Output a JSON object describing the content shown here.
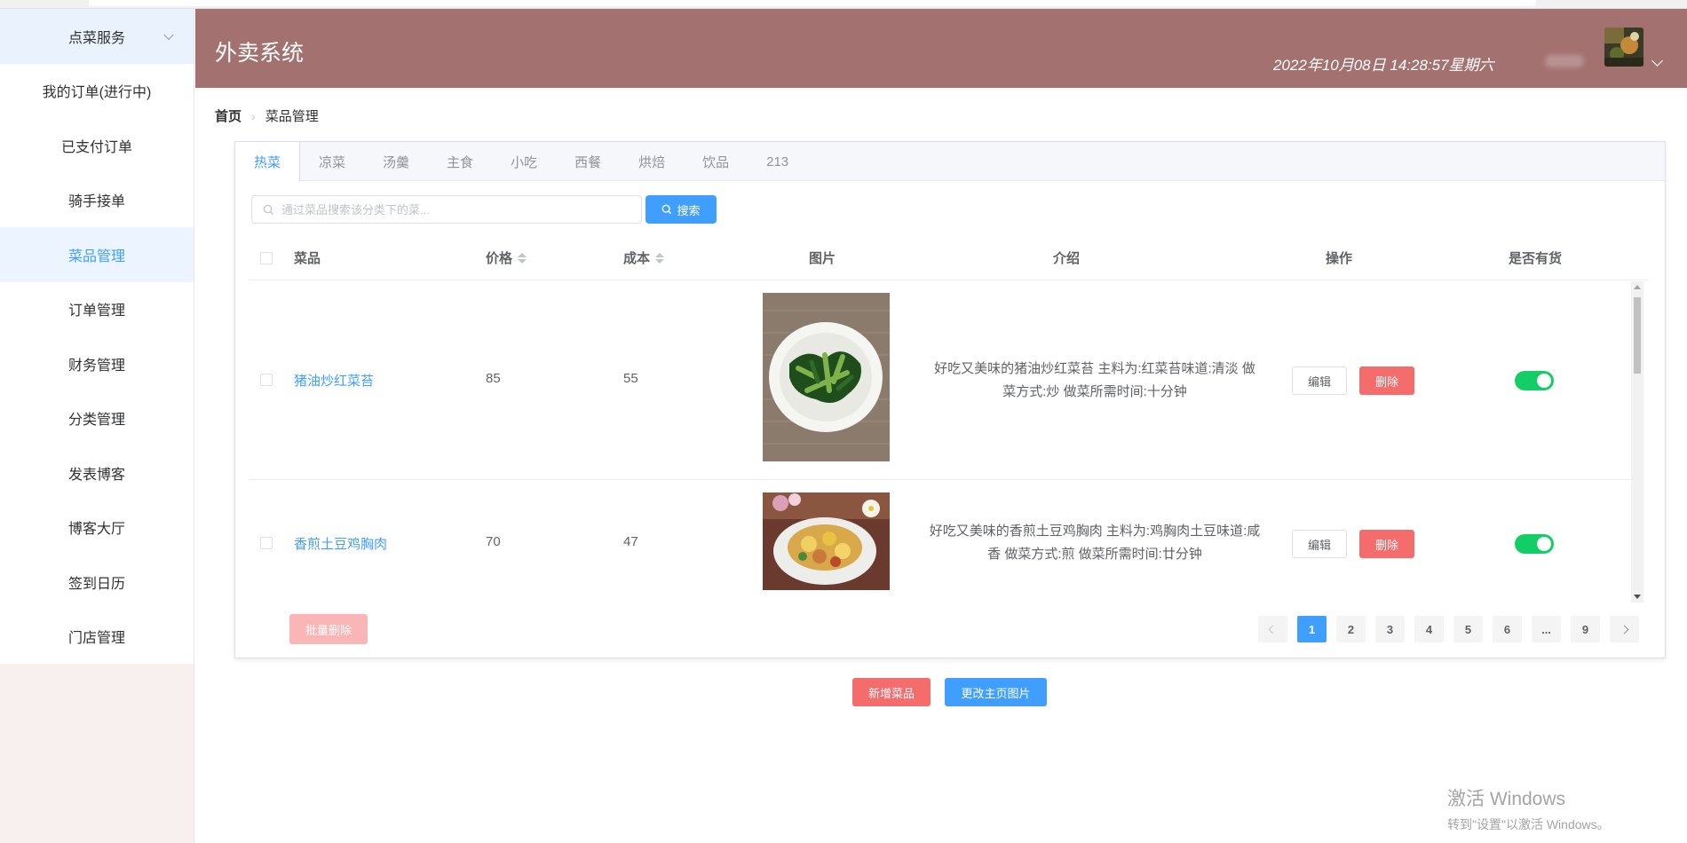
{
  "app": {
    "title": "外卖系统",
    "datetime": "2022年10月08日 14:28:57星期六"
  },
  "sidebar": {
    "items": [
      {
        "label": "点菜服务"
      },
      {
        "label": "我的订单(进行中)"
      },
      {
        "label": "已支付订单"
      },
      {
        "label": "骑手接单"
      },
      {
        "label": "菜品管理"
      },
      {
        "label": "订单管理"
      },
      {
        "label": "财务管理"
      },
      {
        "label": "分类管理"
      },
      {
        "label": "发表博客"
      },
      {
        "label": "博客大厅"
      },
      {
        "label": "签到日历"
      },
      {
        "label": "门店管理"
      }
    ]
  },
  "breadcrumb": {
    "home": "首页",
    "current": "菜品管理"
  },
  "tabs": [
    "热菜",
    "凉菜",
    "汤羹",
    "主食",
    "小吃",
    "西餐",
    "烘焙",
    "饮品",
    "213"
  ],
  "search": {
    "placeholder": "通过菜品搜索该分类下的菜...",
    "button": "搜索"
  },
  "table": {
    "headers": {
      "dish": "菜品",
      "price": "价格",
      "cost": "成本",
      "image": "图片",
      "intro": "介绍",
      "action": "操作",
      "stock": "是否有货"
    },
    "rows": [
      {
        "name": "猪油炒红菜苔",
        "price": "85",
        "cost": "55",
        "intro": "好吃又美味的猪油炒红菜苔 主料为:红菜苔味道:清淡 做菜方式:炒 做菜所需时间:十分钟",
        "edit": "编辑",
        "delete": "删除",
        "in_stock": true
      },
      {
        "name": "香煎土豆鸡胸肉",
        "price": "70",
        "cost": "47",
        "intro": "好吃又美味的香煎土豆鸡胸肉 主料为:鸡胸肉土豆味道:咸香 做菜方式:煎 做菜所需时间:廿分钟",
        "edit": "编辑",
        "delete": "删除",
        "in_stock": true
      }
    ]
  },
  "batch_delete": "批量删除",
  "pagination": {
    "current": 1,
    "pages": [
      "1",
      "2",
      "3",
      "4",
      "5",
      "6",
      "...",
      "9"
    ]
  },
  "actions": {
    "add_dish": "新增菜品",
    "change_cover": "更改主页图片"
  },
  "watermark": {
    "line1": "激活 Windows",
    "line2": "转到\"设置\"以激活 Windows。"
  },
  "colors": {
    "header": "#a37170",
    "primary": "#409eff",
    "danger": "#f56c6c",
    "switch_on": "#13ce66"
  }
}
